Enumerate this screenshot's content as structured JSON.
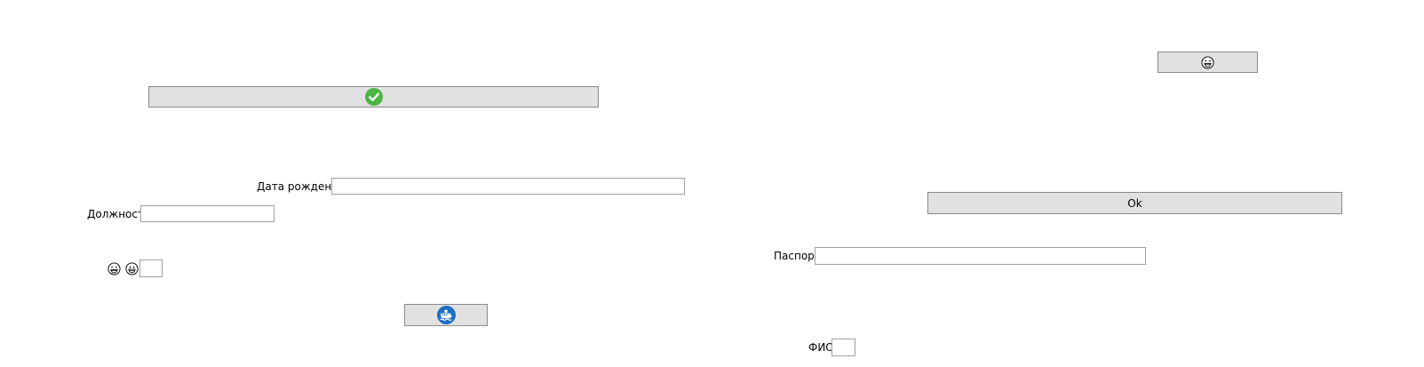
{
  "buttons": {
    "ok_label": "Ok"
  },
  "form": {
    "birth_date_label": "Дата рождения",
    "birth_date_value": "",
    "position_label": "Должность",
    "position_value": "",
    "passport_label": "Паспорт",
    "passport_value": "",
    "fio_label": "ФИО",
    "fio_value": "",
    "small_field_value": ""
  },
  "icons": {
    "check": "check-icon",
    "grin_sweat": "grinning-sweat-emoji-icon",
    "grin": "grinning-emoji-icon",
    "ship": "ship-icon"
  },
  "colors": {
    "button_bg": "#e1e1e1",
    "button_border": "#8a8a8a",
    "check_green": "#4bb543",
    "ship_blue": "#1e6fc4"
  }
}
